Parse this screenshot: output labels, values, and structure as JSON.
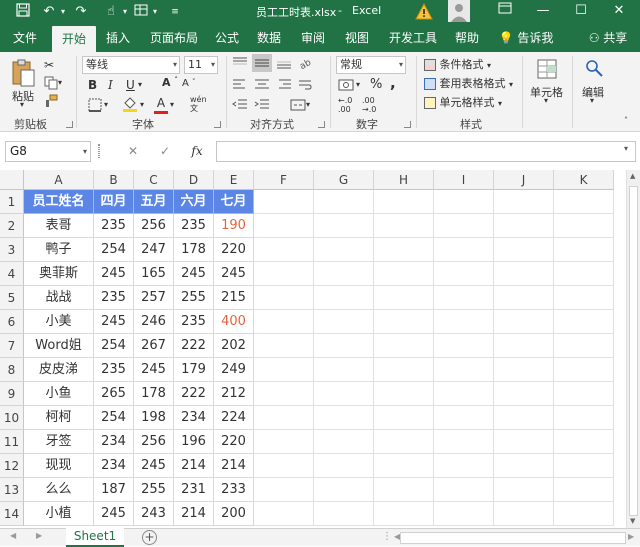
{
  "title_bar": {
    "file_name": "员工工时表.xlsx",
    "app_name": "Excel",
    "minimize": "—",
    "restore": "☐",
    "close": "✕"
  },
  "ribbon_tabs": [
    "文件",
    "开始",
    "插入",
    "页面布局",
    "公式",
    "数据",
    "审阅",
    "视图",
    "开发工具",
    "帮助"
  ],
  "active_tab": "开始",
  "tell_me": "告诉我",
  "share": "共享",
  "ribbon": {
    "paste": "粘贴",
    "clipboard": "剪贴板",
    "font_name": "等线",
    "font_size": "11",
    "font_group": "字体",
    "align_group": "对齐方式",
    "number_format": "常规",
    "number_group": "数字",
    "cond_format": "条件格式",
    "table_format": "套用表格格式",
    "cell_style": "单元格样式",
    "styles_group": "样式",
    "cells": "单元格",
    "editing": "编辑",
    "bold": "B",
    "italic": "I",
    "underline": "U",
    "percent": "%",
    "comma": ",",
    "dec_inc": "←.0\n.00",
    "dec_dec": ".00\n→.0",
    "font_grow": "A",
    "font_shrink": "A",
    "font_color_letter": "A",
    "wen": "wén\n文"
  },
  "name_box": "G8",
  "fx_label": "fx",
  "columns": [
    "A",
    "B",
    "C",
    "D",
    "E",
    "F",
    "G",
    "H",
    "I",
    "J",
    "K"
  ],
  "rows": [
    "1",
    "2",
    "3",
    "4",
    "5",
    "6",
    "7",
    "8",
    "9",
    "10",
    "11",
    "12",
    "13",
    "14"
  ],
  "table": {
    "headers": [
      "员工姓名",
      "四月",
      "五月",
      "六月",
      "七月"
    ],
    "rows": [
      [
        "表哥",
        "235",
        "256",
        "235",
        "190"
      ],
      [
        "鸭子",
        "254",
        "247",
        "178",
        "220"
      ],
      [
        "奥菲斯",
        "245",
        "165",
        "245",
        "245"
      ],
      [
        "战战",
        "235",
        "257",
        "255",
        "215"
      ],
      [
        "小美",
        "245",
        "246",
        "235",
        "400"
      ],
      [
        "Word姐",
        "254",
        "267",
        "222",
        "202"
      ],
      [
        "皮皮涕",
        "235",
        "245",
        "179",
        "249"
      ],
      [
        "小鱼",
        "265",
        "178",
        "222",
        "212"
      ],
      [
        "柯柯",
        "254",
        "198",
        "234",
        "224"
      ],
      [
        "牙签",
        "234",
        "256",
        "196",
        "220"
      ],
      [
        "现现",
        "234",
        "245",
        "214",
        "214"
      ],
      [
        "么么",
        "187",
        "255",
        "231",
        "233"
      ],
      [
        "小植",
        "245",
        "243",
        "214",
        "200"
      ]
    ],
    "highlight_cells": [
      [
        0,
        4
      ],
      [
        4,
        4
      ]
    ]
  },
  "colors": {
    "excel_green": "#217346",
    "header_fill": "#5b86e5",
    "highlight_text": "#e8633a"
  },
  "sheet_tab": "Sheet1",
  "add_sheet": "+"
}
